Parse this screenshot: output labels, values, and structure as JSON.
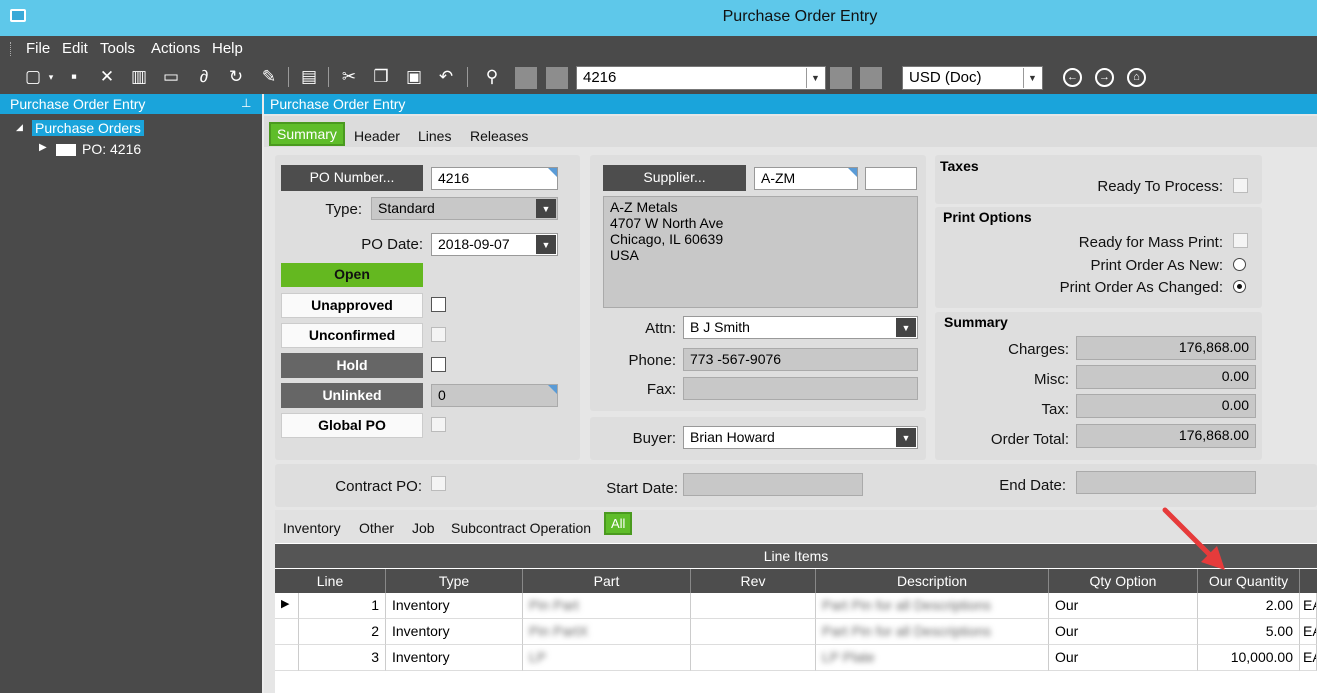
{
  "window": {
    "title": "Purchase Order Entry"
  },
  "menu": [
    "File",
    "Edit",
    "Tools",
    "Actions",
    "Help"
  ],
  "toolbar": {
    "po_number": "4216",
    "currency": "USD (Doc)"
  },
  "left_panel": {
    "title": "Purchase Order Entry",
    "tree_root": "Purchase Orders",
    "tree_child": "PO: 4216"
  },
  "main": {
    "title": "Purchase Order Entry",
    "tabs": [
      "Summary",
      "Header",
      "Lines",
      "Releases"
    ],
    "active_tab": "Summary"
  },
  "po": {
    "po_number_button": "PO Number...",
    "po_number": "4216",
    "type_label": "Type:",
    "type": "Standard",
    "po_date_label": "PO Date:",
    "po_date": "2018-09-07",
    "status_open": "Open",
    "unapproved": "Unapproved",
    "unconfirmed": "Unconfirmed",
    "hold": "Hold",
    "unlinked": "Unlinked",
    "unlinked_value": "0",
    "global_po": "Global PO"
  },
  "supplier": {
    "button": "Supplier...",
    "code": "A-ZM",
    "address": [
      "A-Z Metals",
      "4707 W North Ave",
      "Chicago, IL  60639",
      "USA"
    ],
    "attn_label": "Attn:",
    "attn": "B J Smith",
    "phone_label": "Phone:",
    "phone": "773 -567-9076",
    "fax_label": "Fax:",
    "fax": "",
    "buyer_label": "Buyer:",
    "buyer": "Brian Howard"
  },
  "taxes": {
    "header": "Taxes",
    "ready_to_process": "Ready To Process:"
  },
  "print_options": {
    "header": "Print Options",
    "ready_mass_print": "Ready for Mass Print:",
    "print_as_new": "Print Order As New:",
    "print_as_changed": "Print Order As Changed:"
  },
  "summary": {
    "header": "Summary",
    "charges_label": "Charges:",
    "charges": "176,868.00",
    "misc_label": "Misc:",
    "misc": "0.00",
    "tax_label": "Tax:",
    "tax": "0.00",
    "total_label": "Order Total:",
    "total": "176,868.00"
  },
  "contract": {
    "contract_po_label": "Contract PO:",
    "start_date_label": "Start Date:",
    "end_date_label": "End Date:"
  },
  "line_tabs": [
    "Inventory",
    "Other",
    "Job",
    "Subcontract Operation",
    "All"
  ],
  "grid": {
    "title": "Line Items",
    "columns": [
      "Line",
      "Type",
      "Part",
      "Rev",
      "Description",
      "Qty Option",
      "Our Quantity"
    ],
    "rows": [
      {
        "line": "1",
        "type": "Inventory",
        "part": "Pin Part",
        "rev": "",
        "description": "Part Pin for all Descriptions",
        "qty_option": "Our",
        "qty": "2.00",
        "uom": "EA"
      },
      {
        "line": "2",
        "type": "Inventory",
        "part": "Pin PartX",
        "rev": "",
        "description": "Part Pin for all Descriptions",
        "qty_option": "Our",
        "qty": "5.00",
        "uom": "EA"
      },
      {
        "line": "3",
        "type": "Inventory",
        "part": "LP",
        "rev": "",
        "description": "LP Plate",
        "qty_option": "Our",
        "qty": "10,000.00",
        "uom": "EA"
      }
    ]
  },
  "colors": {
    "accent": "#1aa4db",
    "green": "#64b820",
    "arrow": "#e63b3b"
  }
}
